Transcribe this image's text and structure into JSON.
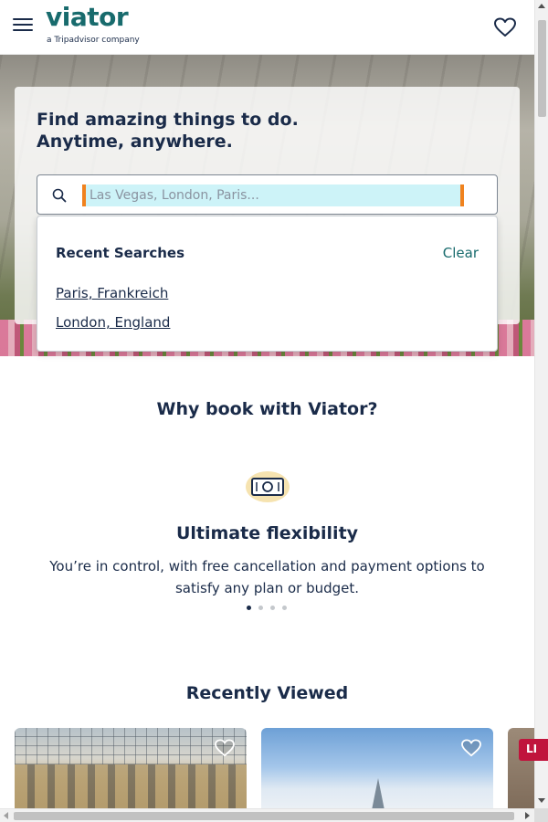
{
  "header": {
    "logo_text": "viator",
    "logo_subtitle": "a Tripadvisor company",
    "menu_icon": "hamburger-menu-icon",
    "wishlist_icon": "heart-icon"
  },
  "hero": {
    "title": "Find amazing things to do. Anytime, anywhere.",
    "search": {
      "placeholder": "Las Vegas, London, Paris...",
      "value": "",
      "icon": "search-icon"
    },
    "recent_searches": {
      "title": "Recent Searches",
      "clear_label": "Clear",
      "items": [
        {
          "label": "Paris, Frankreich"
        },
        {
          "label": "London, England"
        }
      ]
    }
  },
  "why_book": {
    "title": "Why book with Viator?",
    "feature": {
      "icon": "money-icon",
      "title": "Ultimate flexibility",
      "text": "You’re in control, with free cancellation and payment options to satisfy any plan or budget."
    },
    "carousel": {
      "total": 4,
      "active": 1
    }
  },
  "recently_viewed": {
    "title": "Recently Viewed",
    "cards": [
      {
        "image": "museum-glass-roof-courtyard-photo",
        "icon": "heart-outline-icon"
      },
      {
        "image": "london-skyline-shard-photo",
        "icon": "heart-outline-icon"
      },
      {
        "image": "street-photo",
        "badge": "LI"
      }
    ]
  },
  "colors": {
    "brand": "#186b6d",
    "text": "#1a2b49",
    "focus_outline": "#f0821e",
    "input_highlight": "#cdf3f8",
    "badge": "#c0143c"
  }
}
